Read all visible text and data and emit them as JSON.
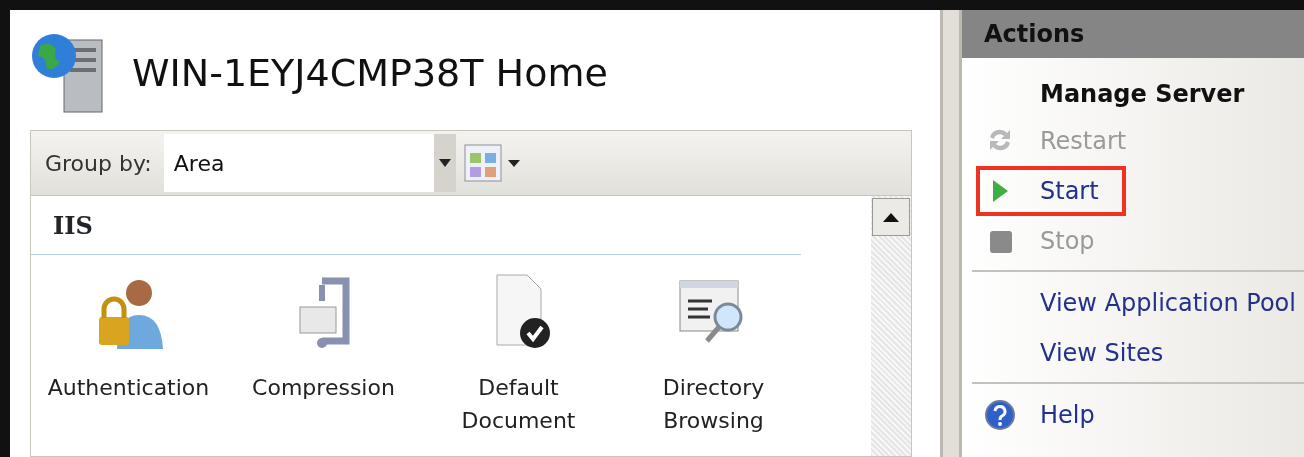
{
  "page": {
    "title": "WIN-1EYJ4CMP38T Home"
  },
  "toolbar": {
    "group_by_label": "Group by:",
    "group_by_value": "Area"
  },
  "section": {
    "title": "IIS"
  },
  "features": [
    {
      "label": "Authentication"
    },
    {
      "label": "Compression"
    },
    {
      "label": "Default Document"
    },
    {
      "label": "Directory Browsing"
    }
  ],
  "actions": {
    "title": "Actions",
    "groups": [
      {
        "heading": "Manage Server",
        "items": [
          {
            "label": "Restart",
            "disabled": true,
            "highlighted": false
          },
          {
            "label": "Start",
            "disabled": false,
            "highlighted": true
          },
          {
            "label": "Stop",
            "disabled": true,
            "highlighted": false
          }
        ]
      },
      {
        "items": [
          {
            "label": "View Application Pool",
            "disabled": false,
            "highlighted": false
          },
          {
            "label": "View Sites",
            "disabled": false,
            "highlighted": false
          }
        ]
      },
      {
        "items": [
          {
            "label": "Help",
            "disabled": false,
            "highlighted": false
          }
        ]
      }
    ]
  }
}
